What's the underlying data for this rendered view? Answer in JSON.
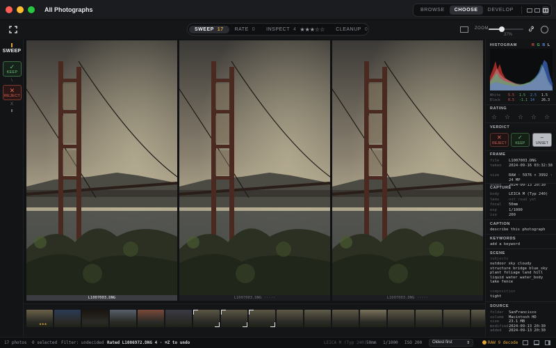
{
  "window": {
    "title": "All Photographs",
    "traffic_colors": [
      "#ff5f57",
      "#febc2e",
      "#28c840"
    ]
  },
  "modes": [
    {
      "label": "BROWSE",
      "active": false
    },
    {
      "label": "CHOOSE",
      "active": true
    },
    {
      "label": "DEVELOP",
      "active": false
    }
  ],
  "workflow": {
    "sweep": {
      "label": "SWEEP",
      "count": "17"
    },
    "rate": {
      "label": "RATE",
      "count": "0"
    },
    "inspect": {
      "label": "INSPECT",
      "count": "4",
      "stars": "★★★☆☆"
    },
    "cleanup": {
      "label": "CLEANUP",
      "count": "0"
    }
  },
  "zoom": {
    "label": "ZOOM",
    "value": "37%",
    "fraction": 0.37
  },
  "left_rail": {
    "title": "SWEEP",
    "keep": {
      "symbol": "✓",
      "label": "KEEP"
    },
    "keep_key": "\\",
    "reject": {
      "symbol": "✕",
      "label": "REJECT"
    },
    "reject_key": "X"
  },
  "photos": [
    {
      "filename": "L1007003.DNG",
      "selected": true,
      "stars": ""
    },
    {
      "filename": "L1007003.DNG",
      "selected": false,
      "stars": "·····"
    },
    {
      "filename": "L1007003.DNG",
      "selected": false,
      "stars": "·····"
    }
  ],
  "filmstrip": [
    {
      "tone": "#6b6148",
      "stars": "★★★"
    },
    {
      "tone": "#2a3b55"
    },
    {
      "tone": "#1a1410"
    },
    {
      "tone": "#58606a"
    },
    {
      "tone": "#7a4a3a"
    },
    {
      "tone": "#3a3a44"
    },
    {
      "tone": "#5b5645",
      "framed": true
    },
    {
      "tone": "#5b5645",
      "framed": true
    },
    {
      "tone": "#5b5645",
      "framed": true
    },
    {
      "tone": "#5e5947"
    },
    {
      "tone": "#615c4a"
    },
    {
      "tone": "#5f5a48"
    },
    {
      "tone": "#7a715a"
    },
    {
      "tone": "#5d5846"
    },
    {
      "tone": "#5e5a48"
    },
    {
      "tone": "#5c5746"
    },
    {
      "tone": "#605b49"
    }
  ],
  "panel": {
    "histogram": {
      "title": "HISTOGRAM",
      "channels": [
        {
          "label": "R",
          "color": "#e0564a"
        },
        {
          "label": "G",
          "color": "#5bbd6b"
        },
        {
          "label": "B",
          "color": "#5a8ad8"
        },
        {
          "label": "L",
          "color": "#d0d2d5"
        }
      ],
      "white": {
        "label": "White",
        "values": [
          "5.5",
          "1.5",
          "2.5",
          "1.5"
        ]
      },
      "black": {
        "label": "Black",
        "values": [
          "0.5",
          "-1.1",
          "14",
          "26.3"
        ]
      }
    },
    "rating": {
      "title": "RATING",
      "stars": [
        "☆",
        "☆",
        "☆",
        "☆",
        "☆"
      ]
    },
    "verdict": {
      "title": "VERDICT",
      "reject": {
        "symbol": "✕",
        "label": "REJECT"
      },
      "keep": {
        "symbol": "✓",
        "label": "KEEP"
      },
      "unset": {
        "symbol": "–",
        "label": "UNSET"
      }
    },
    "frame": {
      "title": "FRAME",
      "rows": [
        {
          "k": "file",
          "v": "L1007003.DNG"
        },
        {
          "k": "taken",
          "v": "2024-09-16 03:32:38"
        },
        {
          "k": "size",
          "v": "RAW · 5976 × 3992 · 24 MP"
        },
        {
          "k": "added",
          "v": "2024-09-13 20:30"
        }
      ]
    },
    "capture": {
      "title": "CAPTURE",
      "rows": [
        {
          "k": "body",
          "v": "LEICA M (Typ 240)",
          "dim": false
        },
        {
          "k": "lens",
          "v": "not read yet",
          "dim": true
        },
        {
          "k": "focal",
          "v": "50mm",
          "dim": false
        },
        {
          "k": "exp",
          "v": "1/1000",
          "dim": false
        },
        {
          "k": "iso",
          "v": "200",
          "dim": false
        }
      ]
    },
    "caption": {
      "title": "CAPTION",
      "text": "describe this photograph"
    },
    "keywords": {
      "title": "KEYWORDS",
      "text": "add a keyword"
    },
    "scene": {
      "title": "SCENE",
      "subjects_label": "subjects",
      "subjects": "outdoor sky cloudy structure bridge blue_sky plant foliage land hill liquid water water_body lake fence",
      "framing_label": "composition",
      "framing": "tight"
    },
    "source": {
      "title": "SOURCE",
      "rows": [
        {
          "k": "folder",
          "v": "SanFrancisco"
        },
        {
          "k": "volume",
          "v": "Macintosh HD"
        },
        {
          "k": "size",
          "v": "23.1 MB"
        },
        {
          "k": "modified",
          "v": "2024-09-13 20:30"
        },
        {
          "k": "added",
          "v": "2024-09-13 20:30"
        }
      ]
    }
  },
  "status": {
    "photos": "17 photos",
    "selected": "0 selected",
    "filter": "Filter: undecided",
    "message": "Rated L1006972.DNG 4 · ⌘Z to undo",
    "camera": "LEICA M (Typ 240)",
    "focal": "50mm",
    "exposure": "1/1000",
    "iso": "ISO 200",
    "sort": "Oldest first",
    "decode": "RAW 9 decode"
  }
}
